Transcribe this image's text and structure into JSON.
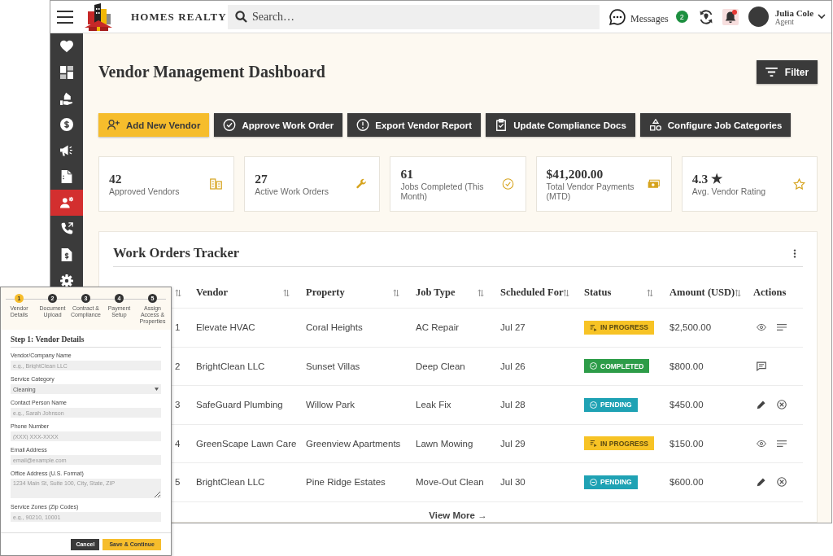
{
  "top_bar": {
    "brand": "HOMES REALTY",
    "search": {
      "placeholder": "Search…"
    },
    "messages": {
      "label": "Messages",
      "count": "2"
    },
    "notifications": {
      "unread": true
    },
    "user": {
      "name": "Julia Cole",
      "role": "Agent"
    }
  },
  "sidebar": {
    "items": [
      {
        "kind": "heart",
        "selected": false
      },
      {
        "kind": "dashboard",
        "selected": false
      },
      {
        "kind": "property",
        "selected": false
      },
      {
        "kind": "payments",
        "selected": false
      },
      {
        "kind": "marketing",
        "selected": false
      },
      {
        "kind": "documents",
        "selected": false
      },
      {
        "kind": "vendors",
        "selected": true
      },
      {
        "kind": "calls",
        "selected": false
      },
      {
        "kind": "invoices",
        "selected": false
      },
      {
        "kind": "settings",
        "selected": false
      }
    ]
  },
  "header": {
    "title": "Vendor Management Dashboard",
    "filter_button": "Filter"
  },
  "actions": [
    {
      "label": "Add New Vendor",
      "primary": true
    },
    {
      "label": "Approve Work Order",
      "primary": false
    },
    {
      "label": "Export Vendor Report",
      "primary": false
    },
    {
      "label": "Update Compliance Docs",
      "primary": false
    },
    {
      "label": "Configure Job Categories",
      "primary": false
    }
  ],
  "stats": [
    {
      "value": "42",
      "label": "Approved Vendors"
    },
    {
      "value": "27",
      "label": "Active Work Orders"
    },
    {
      "value": "61",
      "label": "Jobs Completed (This Month)"
    },
    {
      "value": "$41,200.00",
      "label": "Total Vendor Payments (MTD)"
    },
    {
      "value": "4.3 ★",
      "label": "Avg. Vendor Rating"
    }
  ],
  "work_orders": {
    "title": "Work Orders Tracker",
    "columns": [
      {
        "sortable": true
      },
      {
        "label": "Vendor",
        "sortable": true
      },
      {
        "label": "Property",
        "sortable": true
      },
      {
        "label": "Job Type",
        "sortable": true
      },
      {
        "label": "Scheduled For",
        "sortable": true
      },
      {
        "label": "Status",
        "sortable": true
      },
      {
        "label": "Amount (USD)",
        "sortable": true
      },
      {
        "label": "Actions",
        "sortable": false
      }
    ],
    "rows": [
      {
        "column_1": "1",
        "vendor": "Elevate HVAC",
        "property": "Coral Heights",
        "job_type": "AC Repair",
        "scheduled_for": "Jul 27",
        "status": {
          "label": "IN PROGRESS",
          "kind": "in_progress"
        },
        "amount": "$2,500.00",
        "actions": [
          {
            "kind": "view"
          },
          {
            "kind": "notes"
          }
        ]
      },
      {
        "column_1": "2",
        "vendor": "BrightClean LLC",
        "property": "Sunset Villas",
        "job_type": "Deep Clean",
        "scheduled_for": "Jul 26",
        "status": {
          "label": "COMPLETED",
          "kind": "completed"
        },
        "amount": "$800.00",
        "actions": [
          {
            "kind": "message"
          }
        ]
      },
      {
        "column_1": "3",
        "vendor": "SafeGuard Plumbing",
        "property": "Willow Park",
        "job_type": "Leak Fix",
        "scheduled_for": "Jul 28",
        "status": {
          "label": "PENDING",
          "kind": "pending"
        },
        "amount": "$450.00",
        "actions": [
          {
            "kind": "edit"
          },
          {
            "kind": "cancel"
          }
        ]
      },
      {
        "column_1": "4",
        "vendor": "GreenScape Lawn Care",
        "property": "Greenview Apartments",
        "job_type": "Lawn Mowing",
        "scheduled_for": "Jul 29",
        "status": {
          "label": "IN PROGRESS",
          "kind": "in_progress"
        },
        "amount": "$150.00",
        "actions": [
          {
            "kind": "view"
          },
          {
            "kind": "notes"
          }
        ]
      },
      {
        "column_1": "5",
        "vendor": "BrightClean LLC",
        "property": "Pine Ridge Estates",
        "job_type": "Move-Out Clean",
        "scheduled_for": "Jul 30",
        "status": {
          "label": "PENDING",
          "kind": "pending"
        },
        "amount": "$600.00",
        "actions": [
          {
            "kind": "edit"
          },
          {
            "kind": "cancel"
          }
        ]
      }
    ],
    "view_more": "View More →"
  },
  "vendor_form": {
    "steps": [
      {
        "number": "1",
        "label": "Vendor Details",
        "selected": true
      },
      {
        "number": "2",
        "label": "Document Upload",
        "selected": false
      },
      {
        "number": "3",
        "label": "Contract & Compliance",
        "selected": false
      },
      {
        "number": "4",
        "label": "Payment Setup",
        "selected": false
      },
      {
        "number": "5",
        "label": "Assign Access & Properties",
        "selected": false
      }
    ],
    "heading": "Step 1: Vendor Details",
    "fields": [
      {
        "kind": "text",
        "label": "Vendor/Company Name",
        "placeholder": "e.g., BrightClean LLC"
      },
      {
        "kind": "select",
        "label": "Service Category",
        "value": "Cleaning"
      },
      {
        "kind": "text",
        "label": "Contact Person Name",
        "placeholder": "e.g., Sarah Johnson"
      },
      {
        "kind": "text",
        "label": "Phone Number",
        "placeholder": "(XXX) XXX-XXXX"
      },
      {
        "kind": "text",
        "label": "Email Address",
        "placeholder": "email@example.com"
      },
      {
        "kind": "textarea",
        "label": "Office Address (U.S. Format)",
        "placeholder": "1234 Main St, Suite 100, City, State, ZIP"
      },
      {
        "kind": "text",
        "label": "Service Zones (Zip Codes)",
        "placeholder": "e.g., 90210, 10001"
      }
    ],
    "buttons": [
      {
        "label": "Cancel",
        "primary": false
      },
      {
        "label": "Save & Continue",
        "primary": true
      }
    ]
  }
}
